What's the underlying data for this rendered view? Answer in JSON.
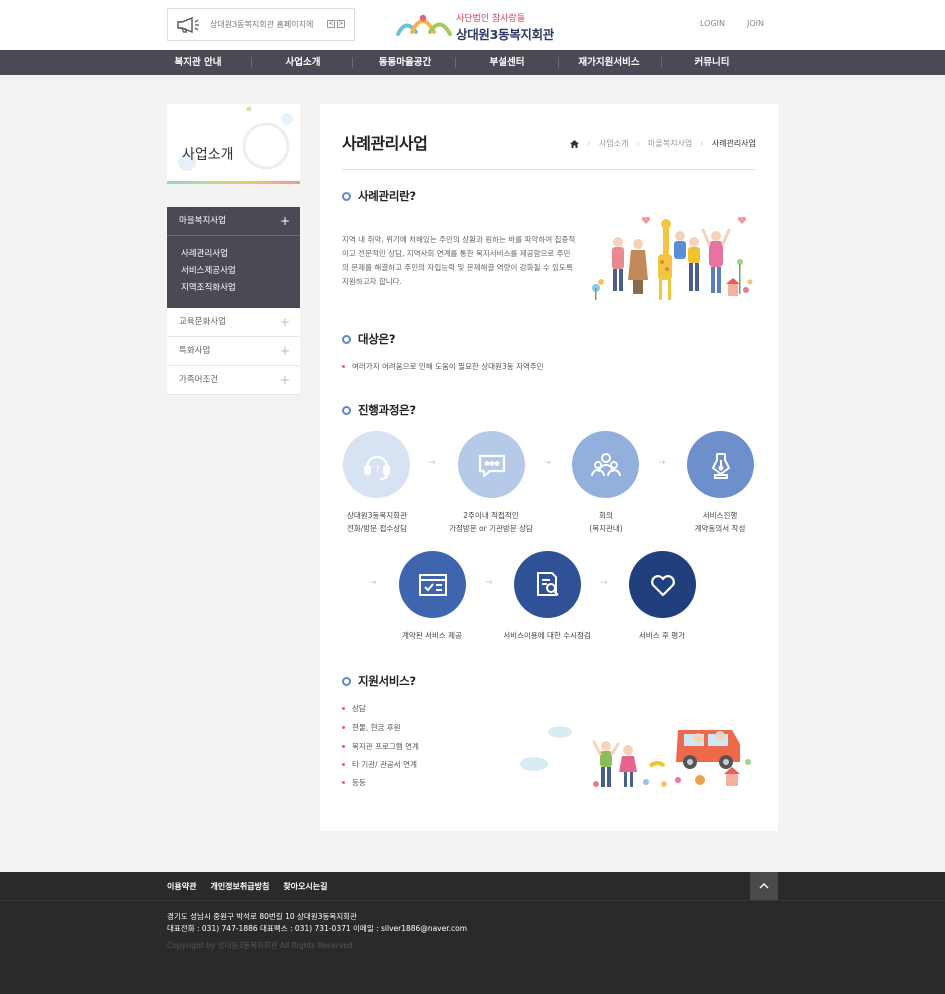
{
  "header": {
    "notice_text": "상대원3동복지회관 홈페이지에",
    "notice_prev": "<",
    "notice_next": ">",
    "logo_sub": "사단법인 참사랑들",
    "logo_main": "상대원3동복지회관",
    "login": "LOGIN",
    "join": "JOIN"
  },
  "nav": {
    "items": [
      "복지관 안내",
      "사업소개",
      "동동마을공간",
      "부설센터",
      "재가지원서비스",
      "커뮤니티"
    ]
  },
  "sidebar": {
    "title": "사업소개",
    "active": "마을복지사업",
    "sub_items": [
      "사례관리사업",
      "서비스제공사업",
      "지역조직화사업"
    ],
    "items": [
      "교육문화사업",
      "특화사업",
      "가족어조건"
    ]
  },
  "page": {
    "title": "사례관리사업",
    "breadcrumb": [
      "사업소개",
      "마을복지사업",
      "사례관리사업"
    ]
  },
  "section1": {
    "heading": "사례관리란?",
    "body": "지역 내 취약, 위기에 처해있는 주민의 상황과 원하는 바를 파악하여 집중적이고 전문적인 상담, 지역사회 연계를 통한 복지서비스를 제공함으로 주민의 문제를 해결하고 주민의 자립능력 및 문제해결 역량이 강화될 수 있도록 지원하고자 합니다."
  },
  "section2": {
    "heading": "대상은?",
    "bullet": "여러가지 어려움으로 인해 도움이 필요한 상대원3동 지역주민"
  },
  "section3": {
    "heading": "진행과정은?",
    "steps": [
      {
        "line1": "상대원3동복지회관",
        "line2": "전화/방문 접수상담",
        "icon": "headset-icon",
        "color": "#d7e2f3"
      },
      {
        "line1": "2주이내 직접적인",
        "line2": "가정방문 or 기관방문 상담",
        "icon": "chat-icon",
        "color": "#b5c9e8"
      },
      {
        "line1": "회의",
        "line2": "(복지관내)",
        "icon": "meeting-icon",
        "color": "#93afdd"
      },
      {
        "line1": "서비스진행",
        "line2": "계약동의서 작성",
        "icon": "pen-icon",
        "color": "#6d90cc"
      },
      {
        "line1": "계약된 서비스 제공",
        "line2": "",
        "icon": "window-icon",
        "color": "#3e65ae"
      },
      {
        "line1": "서비스이용에 대한 수시점검",
        "line2": "",
        "icon": "document-search-icon",
        "color": "#2f5296"
      },
      {
        "line1": "서비스 후 평가",
        "line2": "",
        "icon": "heart-icon",
        "color": "#203f7c"
      }
    ]
  },
  "section4": {
    "heading": "지원서비스?",
    "bullets": [
      "상담",
      "현물, 현금 후원",
      "복지관 프로그램 연계",
      "타 기관/ 관공서 연계",
      "등등"
    ]
  },
  "footer": {
    "links": [
      "이용약관",
      "개인정보취급방침",
      "찾아오시는길"
    ],
    "top_button": "^",
    "address": "경기도 성남시 중원구 박석로 80번길 10 상대원3동복지회관",
    "contact": "대표전화 : 031) 747-1886 대표팩스 : 031) 731-0371 이메일 : silver1886@naver.com",
    "copyright": "Copyright by 상대원3동복지회관 All Rights Reserved."
  },
  "colors": {
    "nav_bg": "#4b4a54",
    "accent_blue": "#5f87c4",
    "bullet_pink": "#e06478",
    "footer_bg": "#2a2a2a"
  }
}
